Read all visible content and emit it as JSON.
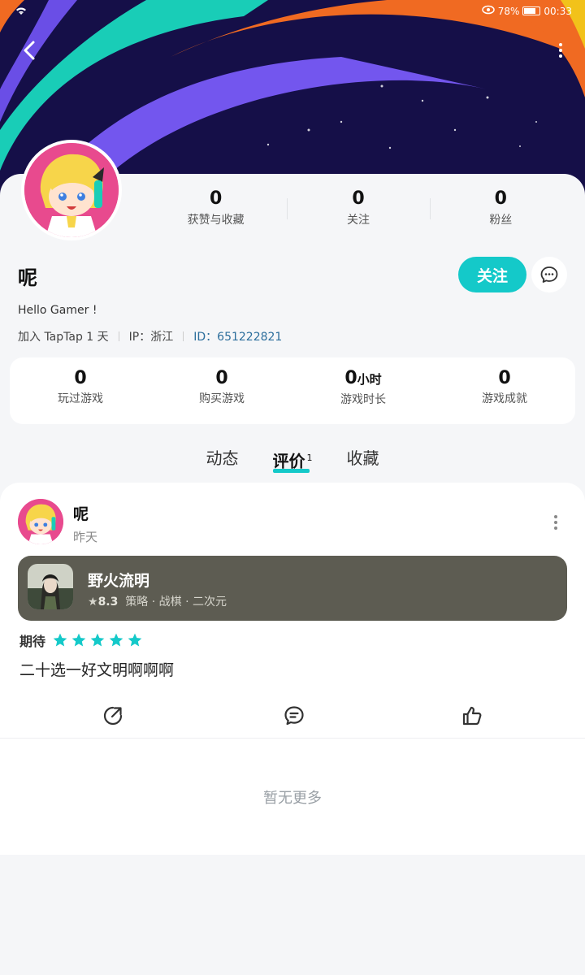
{
  "status_bar": {
    "battery": "78%",
    "time": "00:33"
  },
  "profile": {
    "username": "呢",
    "bio": "Hello Gamer !",
    "joined": "加入 TapTap 1 天",
    "ip": "IP：浙江",
    "user_id": "ID：651222821",
    "follow_label": "关注",
    "stats": [
      {
        "value": "0",
        "label": "获赞与收藏"
      },
      {
        "value": "0",
        "label": "关注"
      },
      {
        "value": "0",
        "label": "粉丝"
      }
    ]
  },
  "game_stats": [
    {
      "value": "0",
      "unit": "",
      "label": "玩过游戏"
    },
    {
      "value": "0",
      "unit": "",
      "label": "购买游戏"
    },
    {
      "value": "0",
      "unit": "小时",
      "label": "游戏时长"
    },
    {
      "value": "0",
      "unit": "",
      "label": "游戏成就"
    }
  ],
  "tabs": [
    {
      "label": "动态",
      "badge": ""
    },
    {
      "label": "评价",
      "badge": "1"
    },
    {
      "label": "收藏",
      "badge": ""
    }
  ],
  "review": {
    "author": "呢",
    "time": "昨天",
    "game": {
      "title": "野火流明",
      "rating": "8.3",
      "tags": "策略 · 战棋 · 二次元"
    },
    "expect_label": "期待",
    "stars": 5,
    "text": "二十选一好文明啊啊啊"
  },
  "footer": {
    "no_more": "暂无更多"
  },
  "colors": {
    "accent": "#14c9c9",
    "banner_bg": "#150f48",
    "game_card_bg": "#5d5c52"
  },
  "icons": [
    "back-icon",
    "more-icon",
    "message-icon",
    "share-icon",
    "comment-icon",
    "like-icon",
    "star-icon"
  ]
}
